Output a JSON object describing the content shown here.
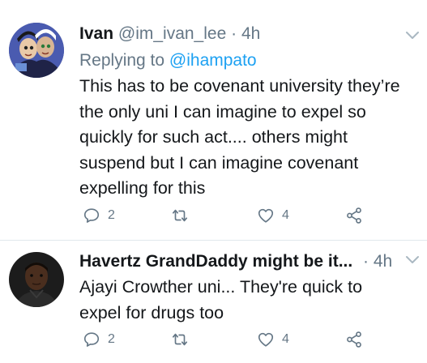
{
  "tweets": [
    {
      "display_name": "Ivan",
      "handle": "@im_ivan_lee",
      "separator": "·",
      "time": "4h",
      "replying_prefix": "Replying to ",
      "replying_to": "@ihampato",
      "body_lines": [
        "This has to be covenant university they’re",
        "the only uni I can imagine to expel so",
        "quickly for such act.... others might",
        "suspend but I can imagine covenant",
        "expelling for this"
      ],
      "reply_count": "2",
      "like_count": "4",
      "icons": {
        "reply": "comment-icon",
        "retweet": "retweet-icon",
        "like": "heart-icon",
        "share": "share-icon",
        "menu": "chevron-down-icon"
      }
    },
    {
      "display_name": "Havertz GrandDaddy might be it...",
      "separator": "·",
      "time": "4h",
      "body_lines": [
        "Ajayi Crowther uni... They're quick to",
        "expel for drugs too"
      ],
      "reply_count": "2",
      "like_count": "4",
      "icons": {
        "reply": "comment-icon",
        "retweet": "retweet-icon",
        "like": "heart-icon",
        "share": "share-icon",
        "menu": "chevron-down-icon"
      }
    }
  ],
  "colors": {
    "text": "#14171a",
    "secondary": "#657786",
    "link": "#1da1f2",
    "divider": "#e1e8ed"
  }
}
